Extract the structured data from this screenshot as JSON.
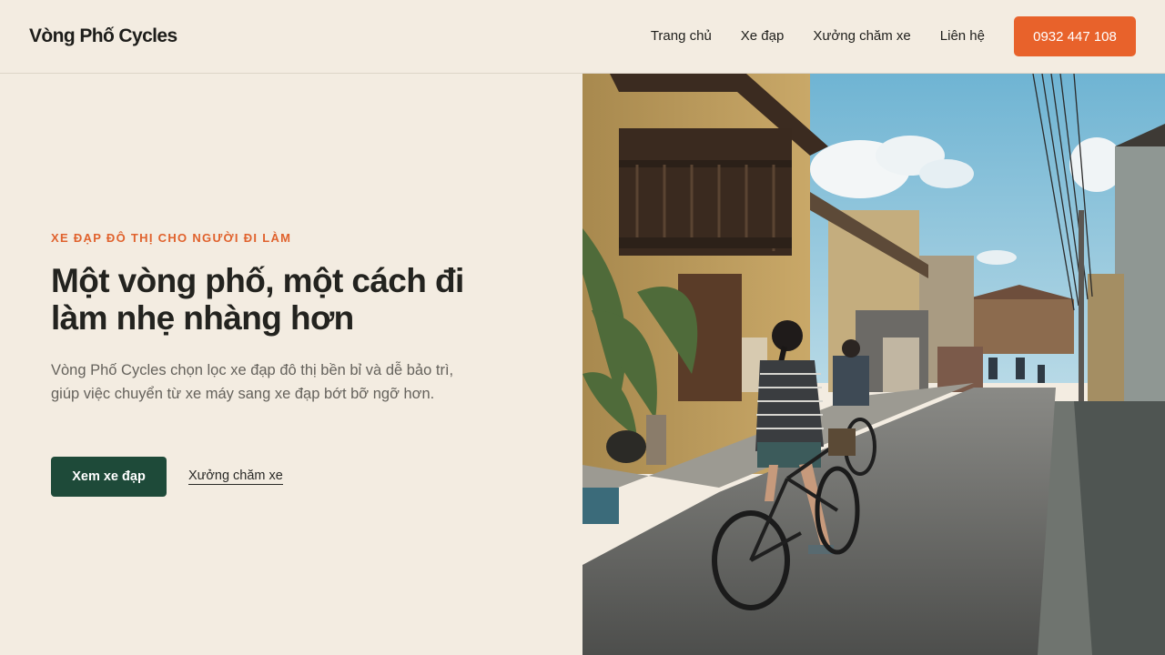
{
  "header": {
    "brand": "Vòng Phố Cycles",
    "nav": [
      {
        "label": "Trang chủ"
      },
      {
        "label": "Xe đạp"
      },
      {
        "label": "Xưởng chăm xe"
      },
      {
        "label": "Liên hệ"
      }
    ],
    "phone_button": "0932 447 108"
  },
  "hero": {
    "eyebrow": "XE ĐẠP ĐÔ THỊ CHO NGƯỜI ĐI LÀM",
    "headline": "Một vòng phố, một cách đi làm nhẹ nhàng hơn",
    "lead": "Vòng Phố Cycles chọn lọc xe đạp đô thị bền bỉ và dễ bảo trì, giúp việc chuyển từ xe máy sang xe đạp bớt bỡ ngỡ hơn.",
    "primary_cta": "Xem xe đạp",
    "secondary_cta": "Xưởng chăm xe"
  },
  "colors": {
    "background": "#f3ece1",
    "accent": "#e8622b",
    "primary_button": "#1e4a39"
  }
}
